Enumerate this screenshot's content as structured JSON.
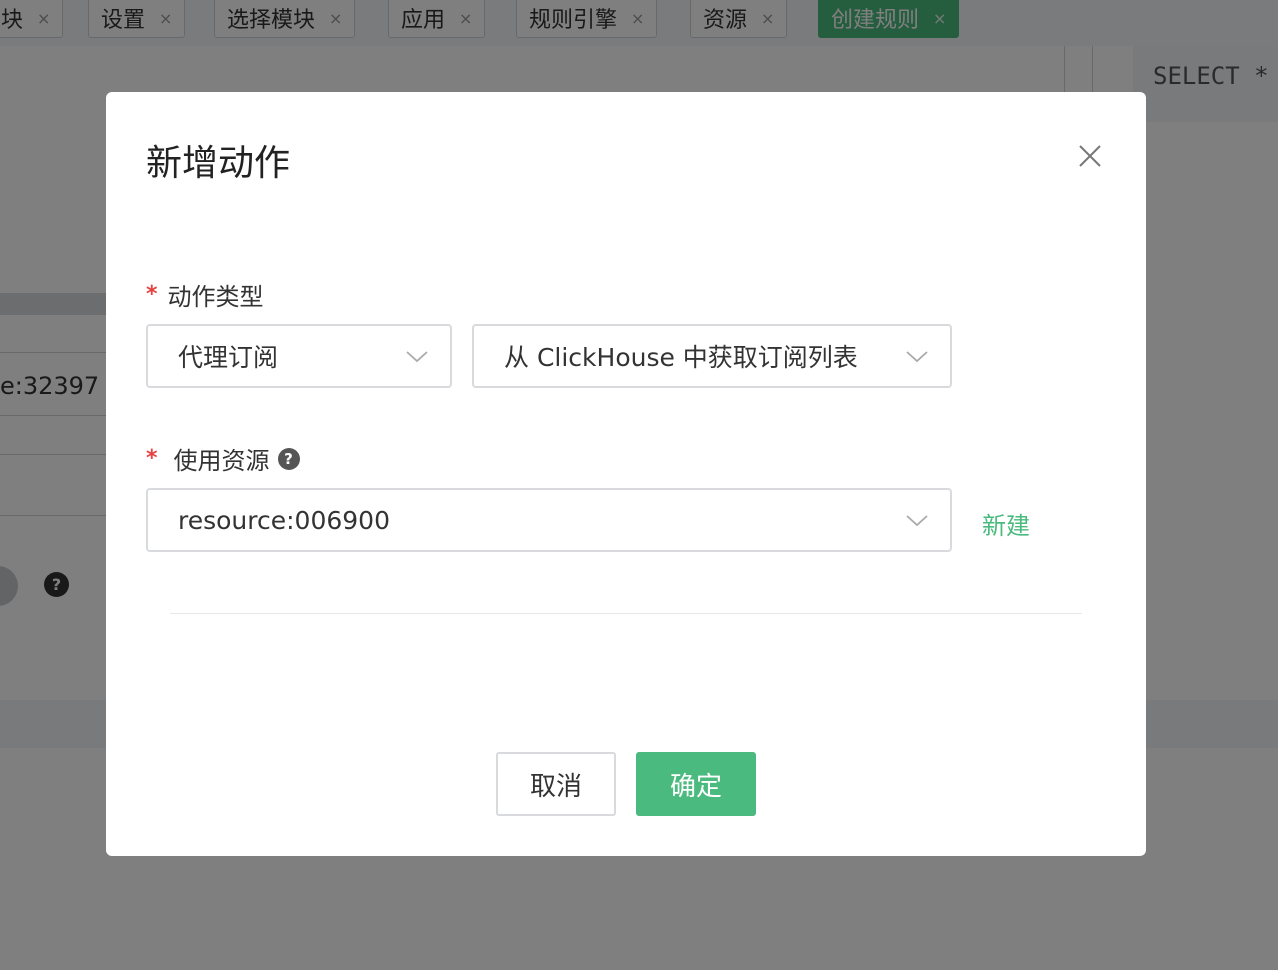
{
  "tabs": [
    {
      "label": "块",
      "close": "×"
    },
    {
      "label": "设置",
      "close": "×"
    },
    {
      "label": "选择模块",
      "close": "×"
    },
    {
      "label": "应用",
      "close": "×"
    },
    {
      "label": "规则引擎",
      "close": "×"
    },
    {
      "label": "资源",
      "close": "×"
    },
    {
      "label": "创建规则",
      "close": "×",
      "active": true
    }
  ],
  "background": {
    "sql_preview": "SELECT *",
    "resource_field_value": "e:32397",
    "help_icon_glyph": "?"
  },
  "modal": {
    "title": "新增动作",
    "action_type": {
      "required_mark": "*",
      "label": "动作类型",
      "category_value": "代理订阅",
      "action_value": "从 ClickHouse 中获取订阅列表"
    },
    "resource": {
      "required_mark": "*",
      "label": "使用资源",
      "help_glyph": "?",
      "value": "resource:006900",
      "new_label": "新建"
    },
    "buttons": {
      "cancel": "取消",
      "confirm": "确定"
    }
  },
  "colors": {
    "primary": "#4bba7e",
    "required": "#e64242",
    "mask": "rgba(0,0,0,0.5)"
  }
}
